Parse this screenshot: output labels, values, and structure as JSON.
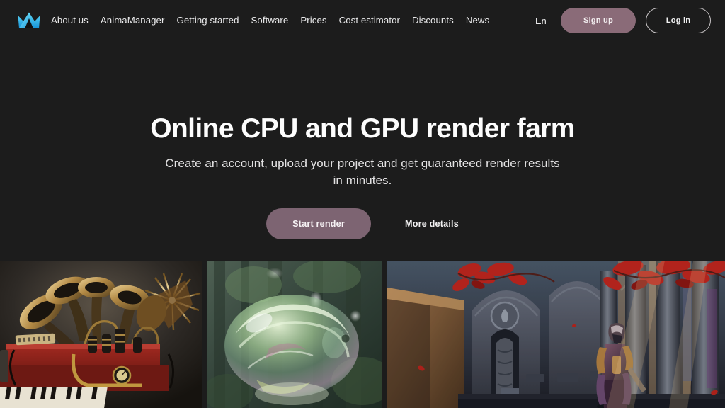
{
  "site": {
    "background_color": "#1c1c1c",
    "accent_color": "#8a6b78",
    "logo_color": "#3fc6f0",
    "logo_name": "anima-crown-logo"
  },
  "header": {
    "logo_alt": "Render farm crown logo",
    "nav": [
      {
        "label": "About us",
        "name": "nav-about-us"
      },
      {
        "label": "AnimaManager",
        "name": "nav-animamanager"
      },
      {
        "label": "Getting started",
        "name": "nav-getting-started"
      },
      {
        "label": "Software",
        "name": "nav-software"
      },
      {
        "label": "Prices",
        "name": "nav-prices"
      },
      {
        "label": "Cost estimator",
        "name": "nav-cost-estimator"
      },
      {
        "label": "Discounts",
        "name": "nav-discounts"
      },
      {
        "label": "News",
        "name": "nav-news"
      }
    ],
    "language": "En",
    "sign_up_label": "Sign up",
    "log_in_label": "Log in"
  },
  "hero": {
    "title": "Online CPU and GPU render farm",
    "subtitle": "Create an account, upload your project and get guaranteed render results in minutes.",
    "primary_cta": "Start render",
    "secondary_cta": "More details"
  },
  "gallery": {
    "items": [
      {
        "name": "gallery-card-steampunk-organ",
        "alt": "Steampunk brass organ with gramophone horns"
      },
      {
        "name": "gallery-card-forest-bubble",
        "alt": "Iridescent soap bubble in a green forest"
      },
      {
        "name": "gallery-card-gothic-temple",
        "alt": "Gothic temple hall with red foliage and an armored warrior"
      }
    ]
  }
}
